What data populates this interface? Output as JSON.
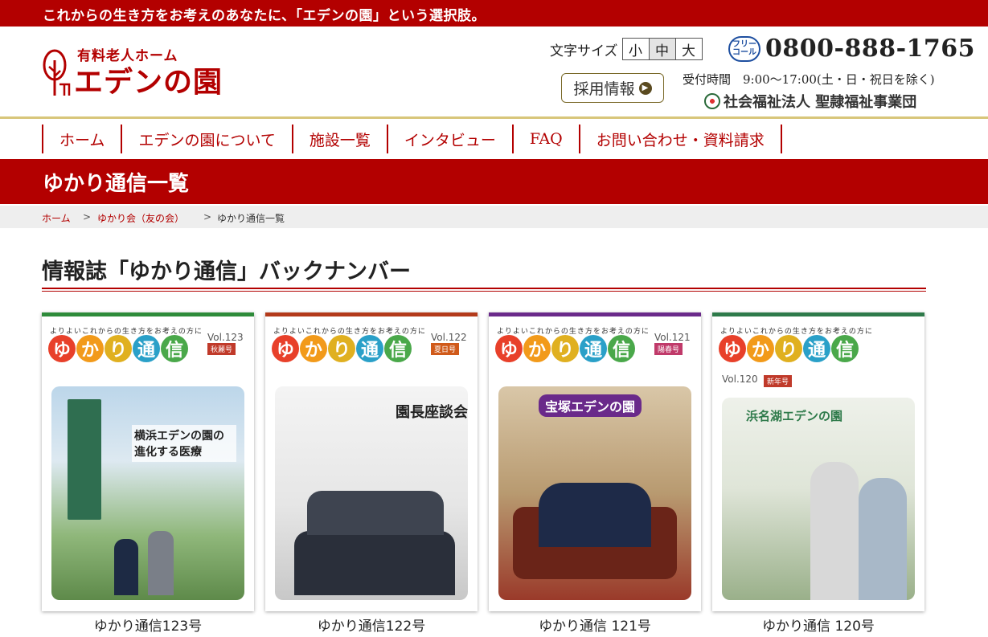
{
  "topbar": {
    "text": "これからの生き方をお考えのあなたに、「エデンの園」という選択肢。"
  },
  "header": {
    "logo_sub": "有料老人ホーム",
    "logo_main": "エデンの園",
    "font_size_label": "文字サイズ",
    "font_sizes": [
      "小",
      "中",
      "大"
    ],
    "freecall_label": "フリーコール",
    "phone": "0800-888-1765",
    "recruit_label": "採用情報",
    "hours": "受付時間　9:00〜17:00(土・日・祝日を除く)",
    "org": "社会福祉法人 聖隷福祉事業団"
  },
  "nav": {
    "items": [
      "ホーム",
      "エデンの園について",
      "施設一覧",
      "インタビュー",
      "FAQ",
      "お問い合わせ・資料請求"
    ]
  },
  "page": {
    "title": "ゆかり通信一覧"
  },
  "breadcrumb": {
    "home": "ホーム",
    "sep": ">",
    "parent": "ゆかり会（友の会）",
    "current": "ゆかり通信一覧"
  },
  "section": {
    "title": "情報誌「ゆかり通信」バックナンバー"
  },
  "cards": [
    {
      "caption": "ゆかり通信123号",
      "cover_tagline": "よりよいこれからの生き方をお考えの方に",
      "cover_title": [
        "ゆ",
        "か",
        "り",
        "通",
        "信"
      ],
      "vol": "Vol.123",
      "season": "秋麗号",
      "headline": "横浜エデンの園の進化する医療",
      "accent": "#2e8b3a"
    },
    {
      "caption": "ゆかり通信122号",
      "cover_tagline": "よりよいこれからの生き方をお考えの方に",
      "cover_title": [
        "ゆ",
        "か",
        "り",
        "通",
        "信"
      ],
      "vol": "Vol.122",
      "season": "夏日号",
      "headline": "園長座談会",
      "accent": "#b33a1a"
    },
    {
      "caption": "ゆかり通信 121号",
      "cover_tagline": "よりよいこれからの生き方をお考えの方に",
      "cover_title": [
        "ゆ",
        "か",
        "り",
        "通",
        "信"
      ],
      "vol": "Vol.121",
      "season": "陽春号",
      "headline": "宝塚エデンの園",
      "accent": "#6a2a8a"
    },
    {
      "caption": "ゆかり通信 120号",
      "cover_tagline": "よりよいこれからの生き方をお考えの方に",
      "cover_title": [
        "ゆ",
        "か",
        "り",
        "通",
        "信"
      ],
      "vol": "Vol.120",
      "season": "新年号",
      "headline": "浜名湖エデンの園",
      "accent": "#2e7a4a"
    }
  ],
  "colors": {
    "brand": "#b30000",
    "nav_border": "#d8c67a"
  }
}
